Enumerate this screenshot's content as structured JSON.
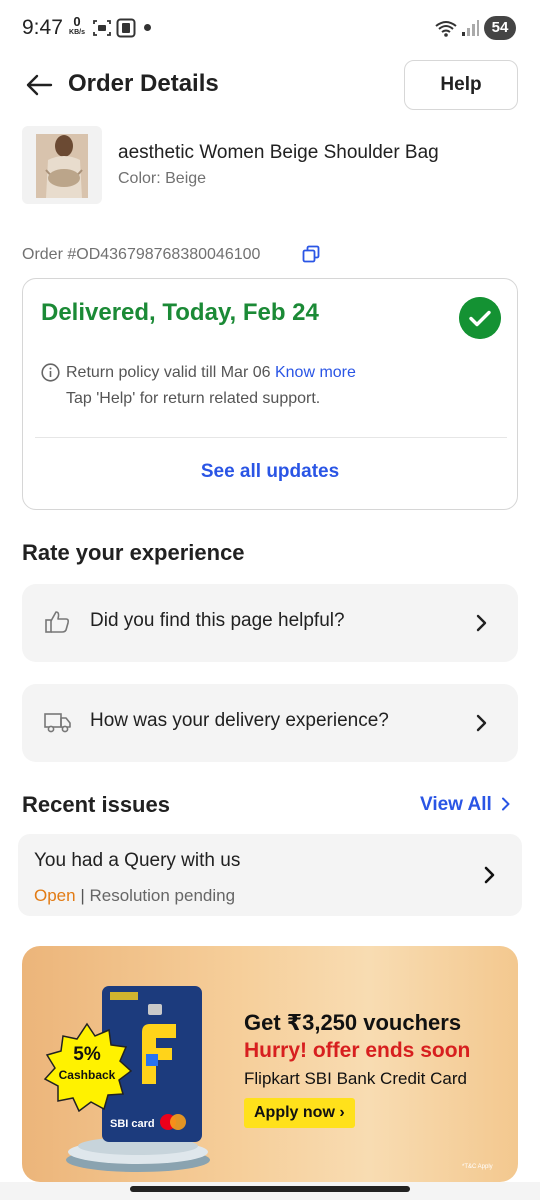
{
  "status_bar": {
    "time": "9:47",
    "net_speed": "0",
    "net_unit": "KB/s",
    "battery": "54"
  },
  "header": {
    "title": "Order Details",
    "help_label": "Help",
    "back_icon": "arrow-left-icon"
  },
  "product": {
    "name": "aesthetic Women Beige Shoulder Bag",
    "color": "Color: Beige"
  },
  "order": {
    "id_label": "Order #OD436798768380046100"
  },
  "status": {
    "headline": "Delivered, Today, Feb 24",
    "return_policy": "Return policy valid till Mar 06",
    "know_more": "Know more",
    "return_help": "Tap 'Help' for return related support.",
    "see_all_updates": "See all updates",
    "accent_green": "#1b8a36"
  },
  "rate": {
    "title": "Rate your experience",
    "items": [
      {
        "label": "Did you find this page helpful?",
        "icon": "thumbs-up-icon"
      },
      {
        "label": "How was your delivery experience?",
        "icon": "delivery-truck-icon"
      }
    ]
  },
  "issues": {
    "title": "Recent issues",
    "view_all": "View All",
    "items": [
      {
        "title": "You had a Query with us",
        "status": "Open",
        "separator": "|",
        "detail": "Resolution pending"
      }
    ]
  },
  "promo": {
    "line1": "Get ₹3,250 vouchers",
    "line2": "Hurry! offer ends soon",
    "line3": "Flipkart SBI Bank Credit Card",
    "cta": "Apply now ›",
    "badge_percent": "5%",
    "badge_label": "Cashback",
    "card_brand": "SBI card",
    "tnc": "*T&C Apply"
  },
  "colors": {
    "link_blue": "#2a55e5",
    "open_orange": "#e27b14",
    "offer_red": "#d71f1f",
    "cta_yellow": "#ffe11b"
  }
}
